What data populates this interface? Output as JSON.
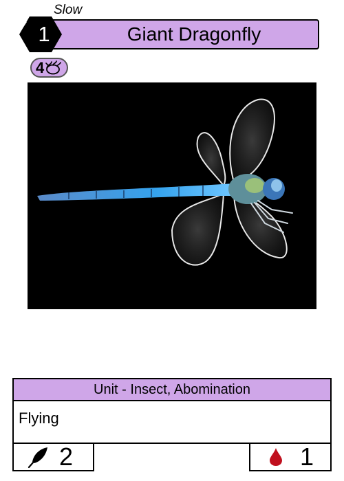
{
  "card": {
    "speed": "Slow",
    "cost": "1",
    "name": "Giant Dragonfly",
    "threshold": {
      "value": "4",
      "icon": "tangled-thread-icon"
    },
    "type_line": "Unit - Insect, Abomination",
    "rules_text": "Flying",
    "stats": {
      "left": {
        "icon": "quill-icon",
        "value": "2"
      },
      "right": {
        "icon": "blood-drop-icon",
        "value": "1"
      }
    },
    "art": {
      "subject": "dragonfly on black background"
    }
  },
  "colors": {
    "accent": "#cfa6e8",
    "cost_badge": "#000000",
    "blood": "#c0101e",
    "dragonfly_body": "#3aa0e8"
  }
}
